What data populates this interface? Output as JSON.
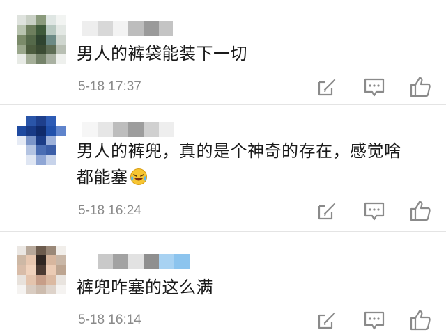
{
  "comments": [
    {
      "text": "男人的裤袋能装下一切",
      "time": "5-18 17:37"
    },
    {
      "text": "男人的裤兜，真的是个神奇的存在，感觉啥",
      "text_line2": "都能塞",
      "time": "5-18 16:24"
    },
    {
      "text": "裤兜咋塞的这么满",
      "time": "5-18 16:14"
    }
  ],
  "icons": {
    "repost": "share-edit-icon",
    "comment": "comment-bubble-icon",
    "like": "thumbs-up-icon",
    "emoji": "laughing-crying-emoji-icon"
  },
  "colors": {
    "text": "#1a1a1a",
    "timestamp": "#8a8a8a",
    "icon": "#8a8a8a",
    "divider": "#e4e4e4"
  }
}
